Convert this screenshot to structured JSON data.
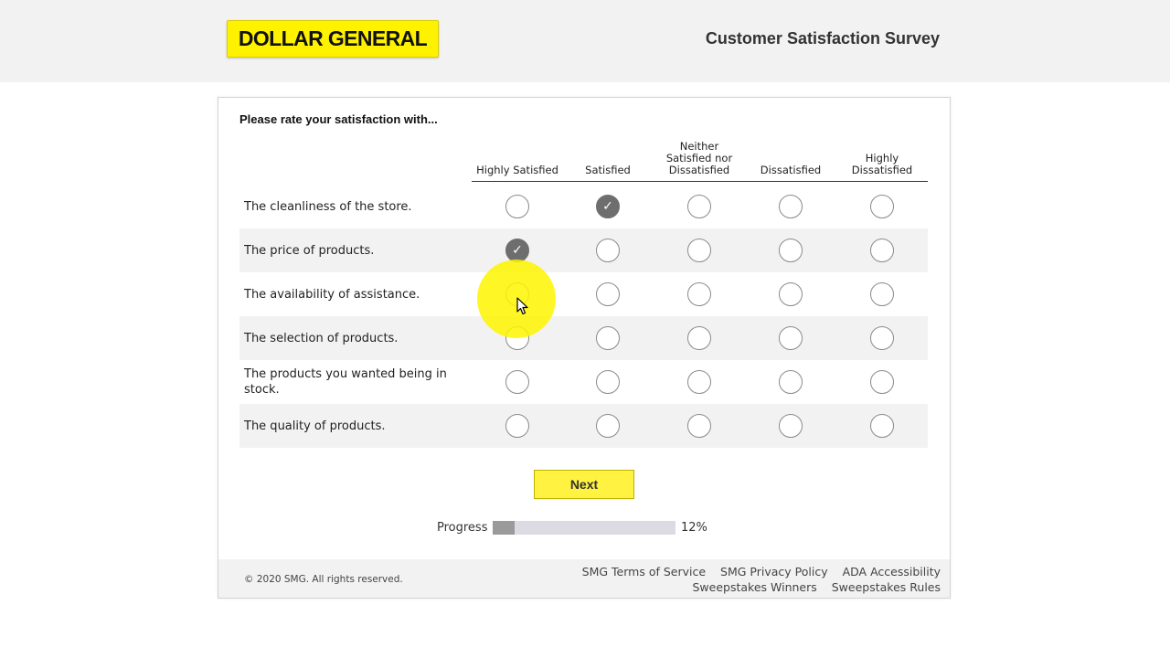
{
  "header": {
    "logo_text": "DOLLAR GENERAL",
    "title": "Customer Satisfaction Survey"
  },
  "question": {
    "prompt": "Please rate your satisfaction with...",
    "scale": [
      [
        "Highly Satisfied"
      ],
      [
        "Satisfied"
      ],
      [
        "Neither",
        "Satisfied nor",
        "Dissatisfied"
      ],
      [
        "Dissatisfied"
      ],
      [
        "Highly",
        "Dissatisfied"
      ]
    ],
    "rows": [
      {
        "label": "The cleanliness of the store.",
        "selected": 1
      },
      {
        "label": "The price of products.",
        "selected": 0
      },
      {
        "label": "The availability of assistance.",
        "selected": null
      },
      {
        "label": "The selection of products.",
        "selected": null
      },
      {
        "label": "The products you wanted being in stock.",
        "selected": null
      },
      {
        "label": "The quality of products.",
        "selected": null
      }
    ]
  },
  "next_label": "Next",
  "progress": {
    "label": "Progress",
    "value": 12,
    "display": "12%"
  },
  "footer": {
    "copyright": "© 2020 SMG. All rights reserved.",
    "links_row1": [
      "SMG Terms of Service",
      "SMG Privacy Policy",
      "ADA Accessibility"
    ],
    "links_row2": [
      "Sweepstakes Winners",
      "Sweepstakes Rules"
    ]
  },
  "colors": {
    "brand_yellow": "#fff200",
    "checked_gray": "#6e6e6e",
    "progress_fill": "#9a9a9a"
  }
}
